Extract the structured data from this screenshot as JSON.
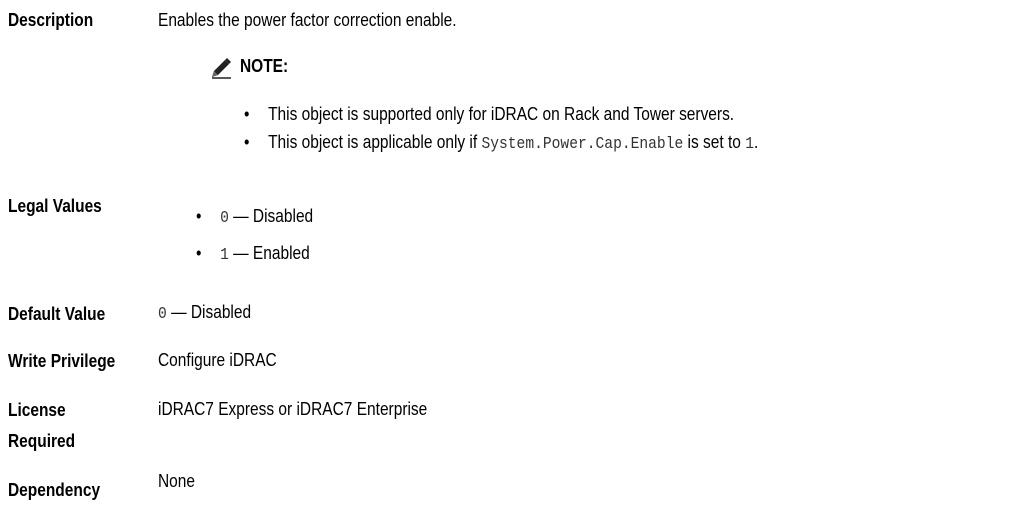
{
  "description": {
    "label": "Description",
    "text": "Enables the power factor correction enable.",
    "note": {
      "title": "NOTE:",
      "icon": "pencil-note-icon",
      "bullets": [
        {
          "pre": "This object is supported only for iDRAC on Rack and Tower servers.",
          "code": "",
          "mid": "",
          "code2": "",
          "post": ""
        },
        {
          "pre": "This object is applicable only if ",
          "code": "System.Power.Cap.Enable",
          "mid": " is set to ",
          "code2": "1",
          "post": "."
        }
      ]
    }
  },
  "legal_values": {
    "label": "Legal Values",
    "items": [
      {
        "code": "0",
        "text": " — Disabled"
      },
      {
        "code": "1",
        "text": " — Enabled"
      }
    ]
  },
  "default_value": {
    "label": "Default Value",
    "code": "0",
    "text": " — Disabled"
  },
  "write_privilege": {
    "label": "Write Privilege",
    "value": "Configure iDRAC"
  },
  "license_required": {
    "label_line1": "License",
    "label_line2": "Required",
    "value": "iDRAC7 Express or iDRAC7 Enterprise"
  },
  "dependency": {
    "label": "Dependency",
    "value": "None"
  }
}
